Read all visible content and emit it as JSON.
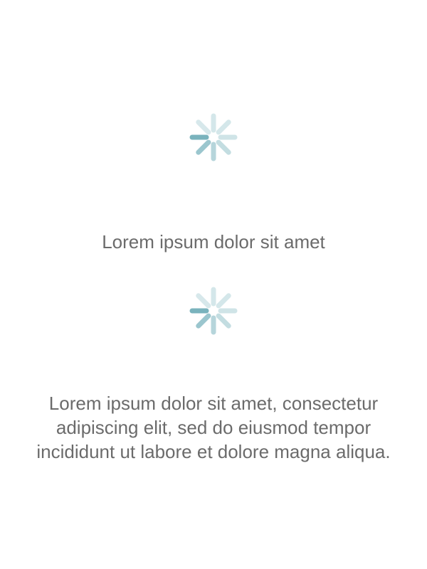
{
  "accent": "#7ab3bd",
  "loaders": [
    {
      "icon": "spinner-icon",
      "message": "Lorem ipsum dolor sit amet"
    },
    {
      "icon": "spinner-icon",
      "message": "Lorem ipsum dolor sit amet, consectetur adipiscing elit, sed do eiusmod tempor incididunt ut labore et dolore magna aliqua."
    }
  ]
}
